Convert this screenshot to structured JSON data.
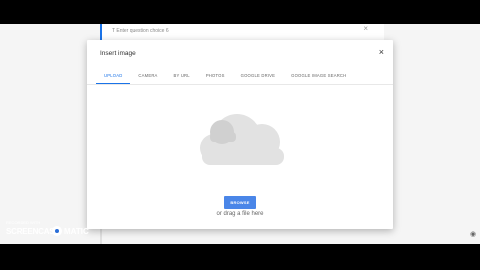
{
  "background_card": {
    "option_text": "T   Enter question choice 6",
    "close_glyph": "×"
  },
  "dialog": {
    "title": "Insert image",
    "close_glyph": "×",
    "tabs": [
      {
        "label": "UPLOAD",
        "active": true
      },
      {
        "label": "CAMERA",
        "active": false
      },
      {
        "label": "BY URL",
        "active": false
      },
      {
        "label": "PHOTOS",
        "active": false
      },
      {
        "label": "GOOGLE DRIVE",
        "active": false
      },
      {
        "label": "GOOGLE IMAGE SEARCH",
        "active": false
      }
    ],
    "upload": {
      "icon": "cloud-upload-icon",
      "browse_label": "BROWSE",
      "drag_text": "or drag a file here"
    }
  },
  "watermark": {
    "recorded_with": "RECORDED WITH",
    "brand_part1": "SCREENCAST",
    "brand_part2": "MATIC"
  },
  "colors": {
    "accent": "#1a73e8",
    "button": "#4a86e8",
    "page_bg": "#f5f5f5",
    "letterbox": "#000000"
  }
}
